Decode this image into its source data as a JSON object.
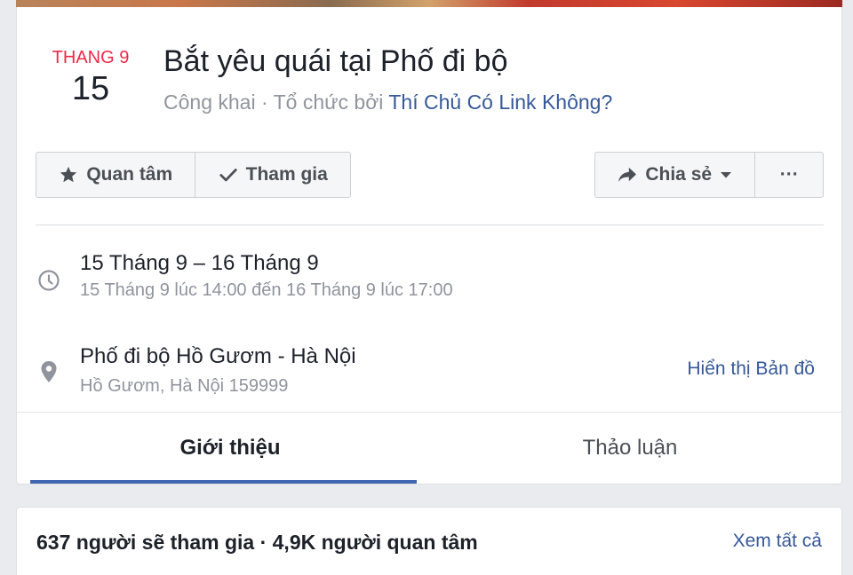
{
  "event": {
    "month": "THANG 9",
    "day": "15",
    "title": "Bắt yêu quái tại Phố đi bộ",
    "privacy": "Công khai · Tổ chức bởi ",
    "host": "Thí Chủ Có Link Không?"
  },
  "actions": {
    "interested_label": "Quan tâm",
    "going_label": "Tham gia",
    "share_label": "Chia sẻ",
    "more_label": "···"
  },
  "details": {
    "date_range": "15 Tháng 9 – 16 Tháng 9",
    "time_range": "15 Tháng 9 lúc 14:00 đến 16 Tháng 9 lúc 17:00",
    "place_name": "Phố đi bộ Hồ Gươm - Hà Nội",
    "place_address": "Hồ Gươm, Hà Nội 159999",
    "map_link": "Hiển thị Bản đồ"
  },
  "tabs": [
    {
      "label": "Giới thiệu",
      "active": true
    },
    {
      "label": "Thảo luận",
      "active": false
    }
  ],
  "attendance": {
    "summary": "637 người sẽ tham gia · 4,9K người quan tâm",
    "see_all": "Xem tất cả"
  },
  "icons": {
    "star": "star-icon",
    "check": "check-icon",
    "share": "share-arrow-icon",
    "caret": "caret-down-icon",
    "clock": "clock-icon",
    "pin": "location-pin-icon"
  },
  "colors": {
    "month_red": "#f02849",
    "link_blue": "#365899",
    "tab_underline": "#4267b2",
    "muted_text": "#90949c"
  }
}
